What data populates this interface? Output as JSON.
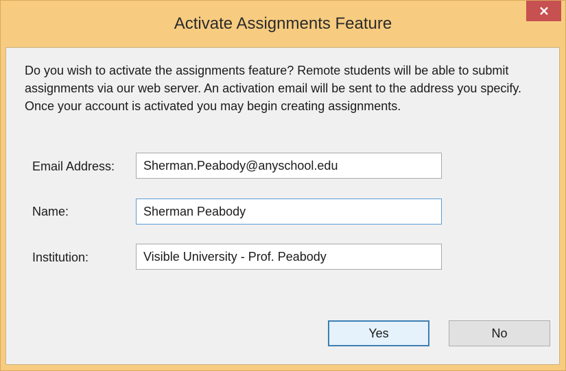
{
  "dialog": {
    "title": "Activate Assignments Feature",
    "close_icon": "close-icon",
    "message": "Do you wish to activate the assignments feature? Remote students will be able to submit assignments via our web server. An activation email will be sent to the address you specify. Once your account is activated you may begin creating assignments.",
    "fields": {
      "email": {
        "label": "Email Address:",
        "value": "Sherman.Peabody@anyschool.edu"
      },
      "name": {
        "label": "Name:",
        "value": "Sherman Peabody"
      },
      "institution": {
        "label": "Institution:",
        "value": "Visible University - Prof. Peabody"
      }
    },
    "buttons": {
      "yes": "Yes",
      "no": "No"
    }
  },
  "colors": {
    "frame": "#f7cc80",
    "close_button": "#c75050",
    "client": "#f0f0f0",
    "focus_border": "#5c9bd6",
    "default_button_border": "#3c7fb1"
  }
}
